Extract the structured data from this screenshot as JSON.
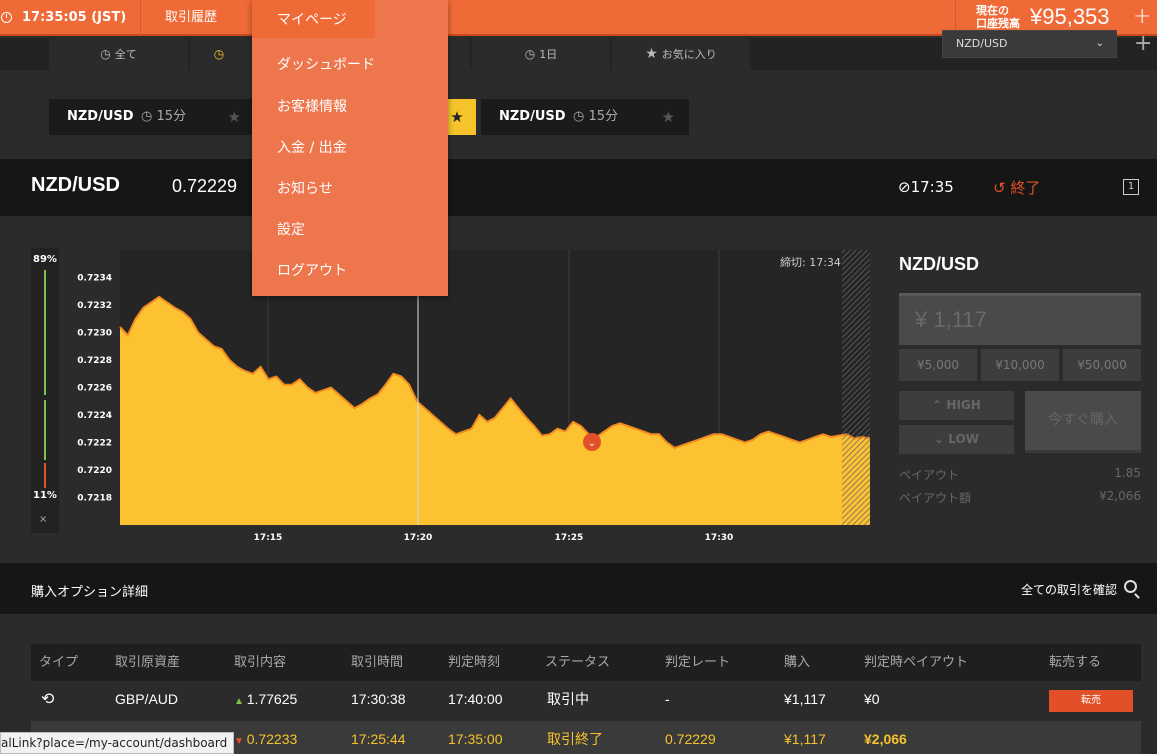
{
  "topbar": {
    "clock": "17:35:05 (JST)",
    "history": "取引履歴",
    "mypage": "マイページ",
    "balance_label_1": "現在の",
    "balance_label_2": "口座残高",
    "balance_value": "¥95,353"
  },
  "tabs": [
    {
      "label": "全て",
      "icon": "clock-icon"
    },
    {
      "label": "",
      "icon": "clock-icon"
    },
    {
      "label": "",
      "icon": ""
    },
    {
      "label": "1日",
      "icon": "clock-icon"
    },
    {
      "label": "お気に入り",
      "icon": "star-icon"
    }
  ],
  "pair_select": {
    "value": "NZD/USD"
  },
  "cards": [
    {
      "symbol": "NZD/USD",
      "period": "15分"
    },
    {
      "symbol": "NZD/USD",
      "period": "15分"
    }
  ],
  "asset": {
    "name": "NZD/USD",
    "rate": "0.72229",
    "time": "17:35",
    "status": "終了",
    "icon_number": "1"
  },
  "meter": {
    "top": "89%",
    "bottom": "11%",
    "close": "×"
  },
  "chart_data": {
    "type": "area",
    "ylim": [
      0.7216,
      0.7236
    ],
    "yticks": [
      "0.7234",
      "0.7232",
      "0.7230",
      "0.7228",
      "0.7226",
      "0.7224",
      "0.7222",
      "0.7220",
      "0.7218"
    ],
    "xticks": [
      "17:15",
      "17:20",
      "17:25",
      "17:30"
    ],
    "cutoff_label": "締切: 17:34",
    "series": [
      {
        "values": [
          0.72304,
          0.72298,
          0.7231,
          0.72318,
          0.72322,
          0.72326,
          0.72322,
          0.72318,
          0.72315,
          0.7231,
          0.723,
          0.72295,
          0.7229,
          0.72288,
          0.7228,
          0.72275,
          0.72272,
          0.7227,
          0.72275,
          0.72266,
          0.72268,
          0.72262,
          0.72262,
          0.72266,
          0.7226,
          0.72256,
          0.72258,
          0.7226,
          0.72255,
          0.7225,
          0.72245,
          0.72248,
          0.72252,
          0.72255,
          0.72262,
          0.7227,
          0.72268,
          0.72262,
          0.7225,
          0.72245,
          0.7224,
          0.72235,
          0.7223,
          0.72226,
          0.72228,
          0.7223,
          0.7224,
          0.72235,
          0.72238,
          0.72245,
          0.72252,
          0.72245,
          0.72238,
          0.72232,
          0.72225,
          0.72226,
          0.7223,
          0.72228,
          0.72235,
          0.72232,
          0.72226,
          0.72224,
          0.72228,
          0.72232,
          0.72234,
          0.72232,
          0.7223,
          0.72228,
          0.72226,
          0.72226,
          0.7222,
          0.72216,
          0.72218,
          0.7222,
          0.72222,
          0.72224,
          0.72226,
          0.72226,
          0.72224,
          0.72222,
          0.7222,
          0.72222,
          0.72226,
          0.72228,
          0.72226,
          0.72224,
          0.72222,
          0.7222,
          0.72222,
          0.72224,
          0.72226,
          0.72224,
          0.72225,
          0.72226,
          0.72223,
          0.72224,
          0.72223
        ]
      }
    ]
  },
  "panel": {
    "title": "NZD/USD",
    "amount": "¥ 1,117",
    "amounts": [
      "¥5,000",
      "¥10,000",
      "¥50,000"
    ],
    "high": "HIGH",
    "low": "LOW",
    "buy": "今すぐ購入",
    "payout_label": "ペイアウト",
    "payout_value": "1.85",
    "payout_amount_label": "ペイアウト額",
    "payout_amount_value": "¥2,066"
  },
  "section": {
    "title": "購入オプション詳細",
    "link": "全ての取引を確認"
  },
  "table": {
    "headers": [
      "タイプ",
      "取引原資産",
      "取引内容",
      "取引時間",
      "判定時刻",
      "ステータス",
      "判定レート",
      "購入",
      "判定時ペイアウト",
      "転売する"
    ],
    "rows": [
      {
        "asset": "GBP/AUD",
        "content": "1.77625",
        "time": "17:30:38",
        "judge": "17:40:00",
        "status": "取引中",
        "rate": "-",
        "buy": "¥1,117",
        "payout": "¥0",
        "sell": "転売"
      },
      {
        "asset": "",
        "content": "0.72233",
        "time": "17:25:44",
        "judge": "17:35:00",
        "status": "取引終了",
        "rate": "0.72229",
        "buy": "¥1,117",
        "payout": "¥2,066",
        "sell": ""
      }
    ]
  },
  "menu": {
    "items": [
      "ダッシュボード",
      "お客様情報",
      "入金 / 出金",
      "お知らせ",
      "設定",
      "ログアウト"
    ]
  },
  "status_tip": "alLink?place=/my-account/dashboard",
  "colors": {
    "accent": "#ef6a36",
    "gold": "#f6c42a",
    "red": "#e2502a",
    "green": "#7ec24a"
  }
}
